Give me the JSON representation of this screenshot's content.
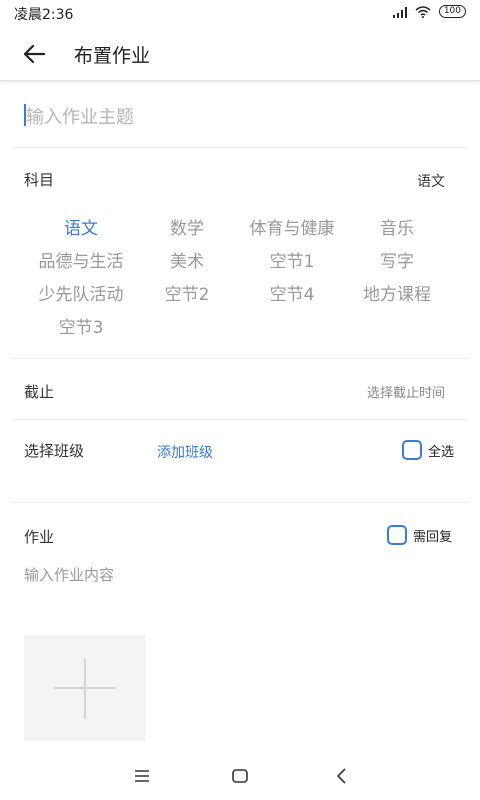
{
  "status_bar": {
    "time": "凌晨2:36",
    "battery": "100"
  },
  "header": {
    "title": "布置作业"
  },
  "topic": {
    "placeholder": "输入作业主题"
  },
  "subject_section": {
    "label": "科目",
    "selected": "语文",
    "options": [
      "语文",
      "数学",
      "体育与健康",
      "音乐",
      "品德与生活",
      "美术",
      "空节1",
      "写字",
      "少先队活动",
      "空节2",
      "空节4",
      "地方课程",
      "空节3"
    ]
  },
  "deadline": {
    "label": "截止",
    "hint": "选择截止时间"
  },
  "class_section": {
    "label": "选择班级",
    "add_link": "添加班级",
    "select_all": "全选"
  },
  "homework": {
    "label": "作业",
    "need_reply": "需回复",
    "content_placeholder": "输入作业内容"
  },
  "colors": {
    "accent": "#3b7bd8",
    "inactive": "#999999",
    "divider": "#ececec"
  }
}
